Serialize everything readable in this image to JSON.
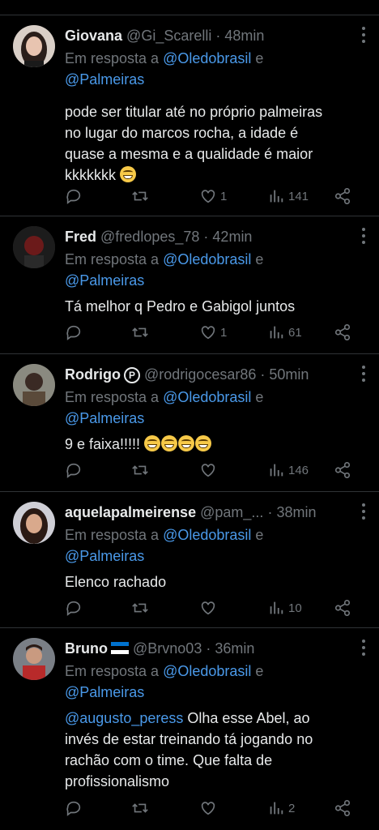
{
  "reply_prefix": "Em resposta a",
  "reply_and": "e",
  "accent_color": "#4a99e9",
  "tweets": [
    {
      "name": "Giovana",
      "handle": "@Gi_Scarelli",
      "sep": "·",
      "time": "48min",
      "mention1": "@Oledobrasil",
      "mention2": "@Palmeiras",
      "text_lines": [
        "pode ser titular até no próprio palmeiras",
        "no lugar do marcos rocha, a idade é",
        "quase a mesma e a qualidade é maior",
        "kkkkkkk"
      ],
      "likes": "1",
      "views": "141"
    },
    {
      "name": "Fred",
      "handle": "@fredlopes_78",
      "sep": "·",
      "time": "42min",
      "mention1": "@Oledobrasil",
      "mention2": "@Palmeiras",
      "text": "Tá melhor q Pedro e Gabigol juntos",
      "likes": "1",
      "views": "61"
    },
    {
      "name": "Rodrigo",
      "badge": "P",
      "handle": "@rodrigocesar86",
      "sep": "·",
      "time": "50min",
      "mention1": "@Oledobrasil",
      "mention2": "@Palmeiras",
      "text": "9 e faixa!!!!!",
      "likes": "",
      "views": "146"
    },
    {
      "name": "aquelapalmeirense",
      "handle": "@pam_...",
      "sep": "·",
      "time": "38min",
      "mention1": "@Oledobrasil",
      "mention2": "@Palmeiras",
      "text": "Elenco rachado",
      "likes": "",
      "views": "10"
    },
    {
      "name": "Bruno",
      "handle": "@Brvno03",
      "sep": "·",
      "time": "36min",
      "mention1": "@Oledobrasil",
      "mention2": "@Palmeiras",
      "text_mention": "@augusto_peress",
      "text_lines": [
        "Olha esse Abel, ao",
        "invés de estar treinando tá jogando no",
        "rachão com o time. Que falta de",
        "profissionalismo"
      ],
      "likes": "",
      "views": "2"
    }
  ]
}
